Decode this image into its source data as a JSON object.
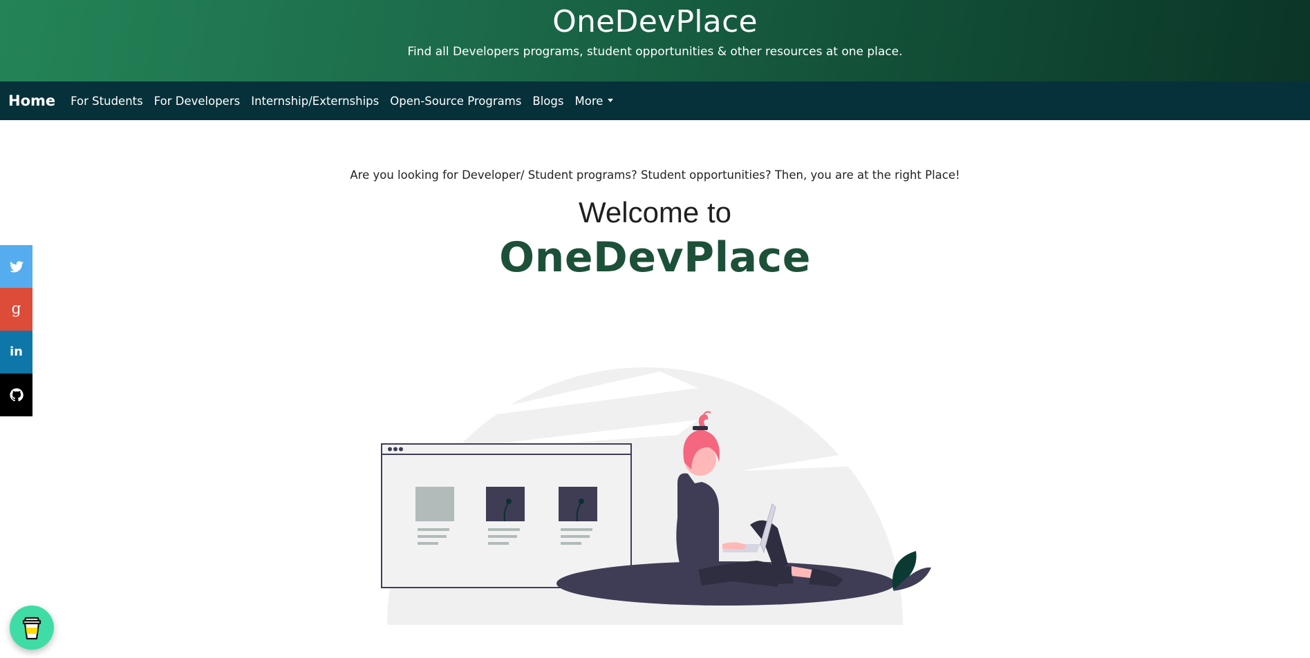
{
  "header": {
    "title": "OneDevPlace",
    "subtitle": "Find all Developers programs, student opportunities & other resources at one place."
  },
  "nav": {
    "brand": "Home",
    "items": [
      {
        "label": "For Students"
      },
      {
        "label": "For Developers"
      },
      {
        "label": "Internship/Externships"
      },
      {
        "label": "Open-Source Programs"
      },
      {
        "label": "Blogs"
      }
    ],
    "more_label": "More"
  },
  "hero": {
    "intro": "Are you looking for Developer/ Student programs? Student opportunities? Then, you are at the right Place!",
    "welcome": "Welcome to",
    "brand": "OneDevPlace"
  },
  "social": {
    "items": [
      {
        "name": "twitter-icon",
        "glyph": "",
        "color": "#55acee"
      },
      {
        "name": "google-icon",
        "glyph": "g",
        "color": "#dd4b39"
      },
      {
        "name": "linkedin-icon",
        "glyph": "in",
        "color": "#0e76a8"
      },
      {
        "name": "github-icon",
        "glyph": "",
        "color": "#000000"
      }
    ]
  },
  "floating": {
    "icon": "coffee-cup-icon",
    "color": "#40dca5"
  },
  "colors": {
    "banner_gradient_start": "#248457",
    "banner_gradient_end": "#0b3527",
    "nav_bg": "#06313a",
    "brand_green": "#1d5038"
  }
}
